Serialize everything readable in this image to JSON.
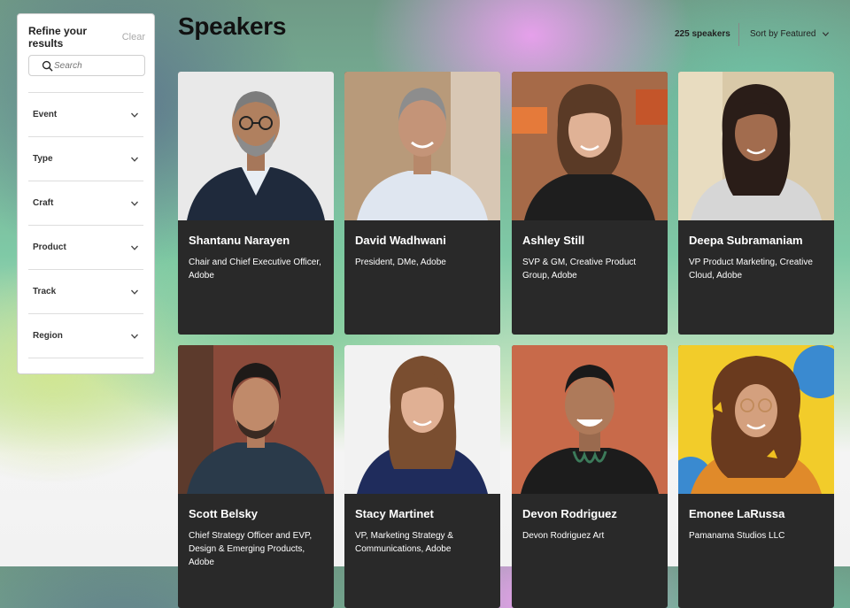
{
  "sidebar": {
    "title": "Refine your results",
    "clear_label": "Clear",
    "search_placeholder": "Search",
    "filters": [
      {
        "label": "Event"
      },
      {
        "label": "Type"
      },
      {
        "label": "Craft"
      },
      {
        "label": "Product"
      },
      {
        "label": "Track"
      },
      {
        "label": "Region"
      }
    ]
  },
  "header": {
    "title": "Speakers",
    "count": "225 speakers",
    "sort_label": "Sort by Featured"
  },
  "speakers": [
    {
      "name": "Shantanu Narayen",
      "role": "Chair and Chief Executive Officer, Adobe"
    },
    {
      "name": "David Wadhwani",
      "role": "President, DMe, Adobe"
    },
    {
      "name": "Ashley Still",
      "role": "SVP & GM, Creative Product Group, Adobe"
    },
    {
      "name": "Deepa Subramaniam",
      "role": "VP Product Marketing, Creative Cloud, Adobe"
    },
    {
      "name": "Scott Belsky",
      "role": "Chief Strategy Officer and EVP, Design & Emerging Products, Adobe"
    },
    {
      "name": "Stacy Martinet",
      "role": "VP, Marketing Strategy & Communications, Adobe"
    },
    {
      "name": "Devon Rodriguez",
      "role": "Devon Rodriguez Art"
    },
    {
      "name": "Emonee LaRussa",
      "role": "Pamanama Studios LLC"
    }
  ]
}
